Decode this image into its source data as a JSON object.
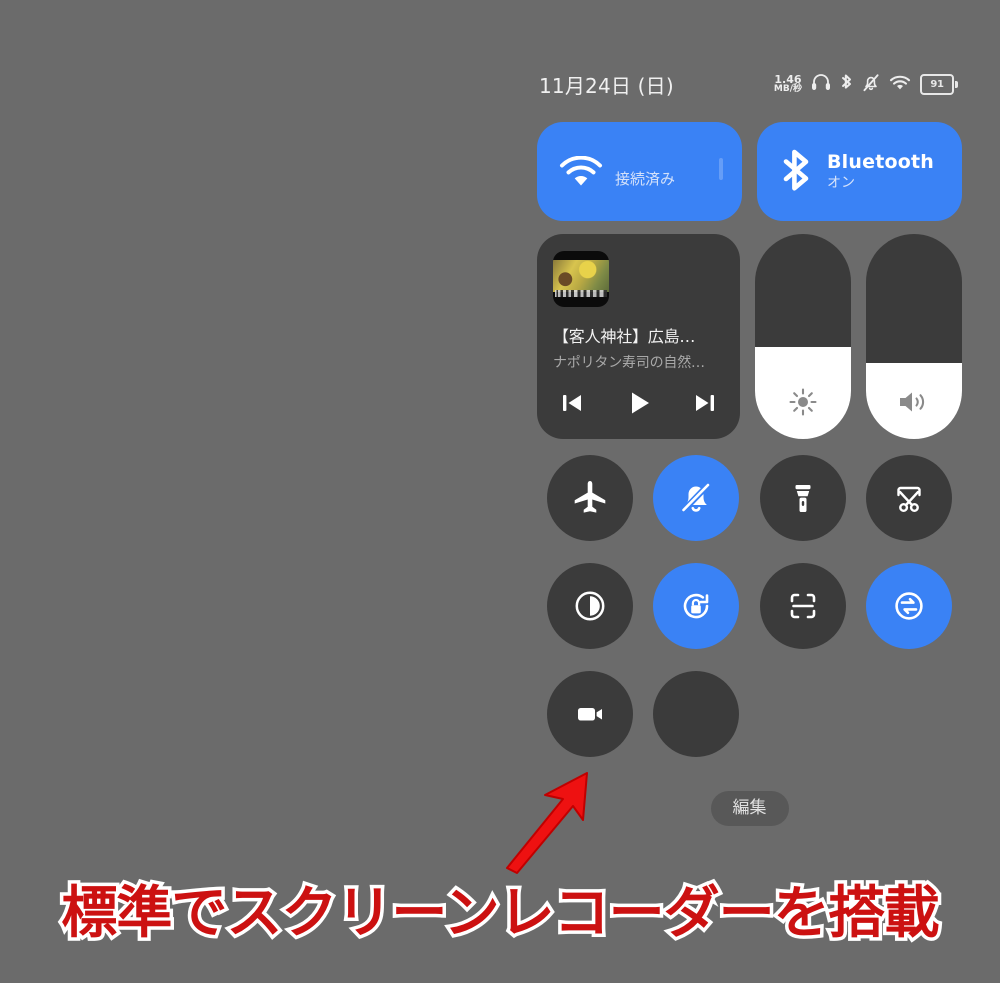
{
  "statusbar": {
    "date": "11月24日 (日)",
    "network_speed_rate": "1.46",
    "network_speed_unit": "MB/秒",
    "icons": [
      "headphone-icon",
      "bluetooth-icon",
      "bell-muted-icon",
      "wifi-icon",
      "battery-icon"
    ],
    "battery_percent": "91"
  },
  "connectivity": {
    "wifi": {
      "name": "wifi-tile",
      "subtitle": "接続済み",
      "state": "on"
    },
    "bluetooth": {
      "name": "bluetooth-tile",
      "title": "Bluetooth",
      "subtitle": "オン",
      "state": "on"
    }
  },
  "media": {
    "title": "【客人神社】広島…",
    "artist": "ナポリタン寿司の自然…",
    "previous_label": "前へ",
    "play_label": "再生",
    "next_label": "次へ"
  },
  "sliders": {
    "brightness": {
      "label": "明るさ",
      "value": 45
    },
    "volume": {
      "label": "音量",
      "value": 37
    }
  },
  "toggles": [
    {
      "label": "機内モード",
      "icon": "airplane-icon",
      "state": "off"
    },
    {
      "label": "サイレント",
      "icon": "bell-muted-icon",
      "state": "on"
    },
    {
      "label": "懐中電灯",
      "icon": "flashlight-icon",
      "state": "off"
    },
    {
      "label": "スクリーンショット",
      "icon": "scissors-crop-icon",
      "state": "off"
    },
    {
      "label": "ダークモード",
      "icon": "contrast-icon",
      "state": "off"
    },
    {
      "label": "画面の自動回転",
      "icon": "rotation-lock-icon",
      "state": "on"
    },
    {
      "label": "スキャン",
      "icon": "scan-frame-icon",
      "state": "off"
    },
    {
      "label": "データ転送",
      "icon": "sync-transfer-icon",
      "state": "on"
    },
    {
      "label": "スクリーンレコーダー",
      "icon": "video-camera-icon",
      "state": "off"
    },
    {
      "label": "",
      "icon": "empty-icon",
      "state": "empty"
    }
  ],
  "edit_button": {
    "label": "編集"
  },
  "annotation": {
    "caption": "標準でスクリーンレコーダーを搭載",
    "arrow": "red-arrow-up-right",
    "caption_color": "#cc1111",
    "caption_outline_color": "#ffffff"
  },
  "colors": {
    "background": "#6b6b6b",
    "tile_off": "#3b3b3b",
    "accent_on": "#3a82f5",
    "slider_fill": "#ffffff",
    "text_primary": "#ffffff",
    "text_secondary": "#a8a8a8"
  }
}
